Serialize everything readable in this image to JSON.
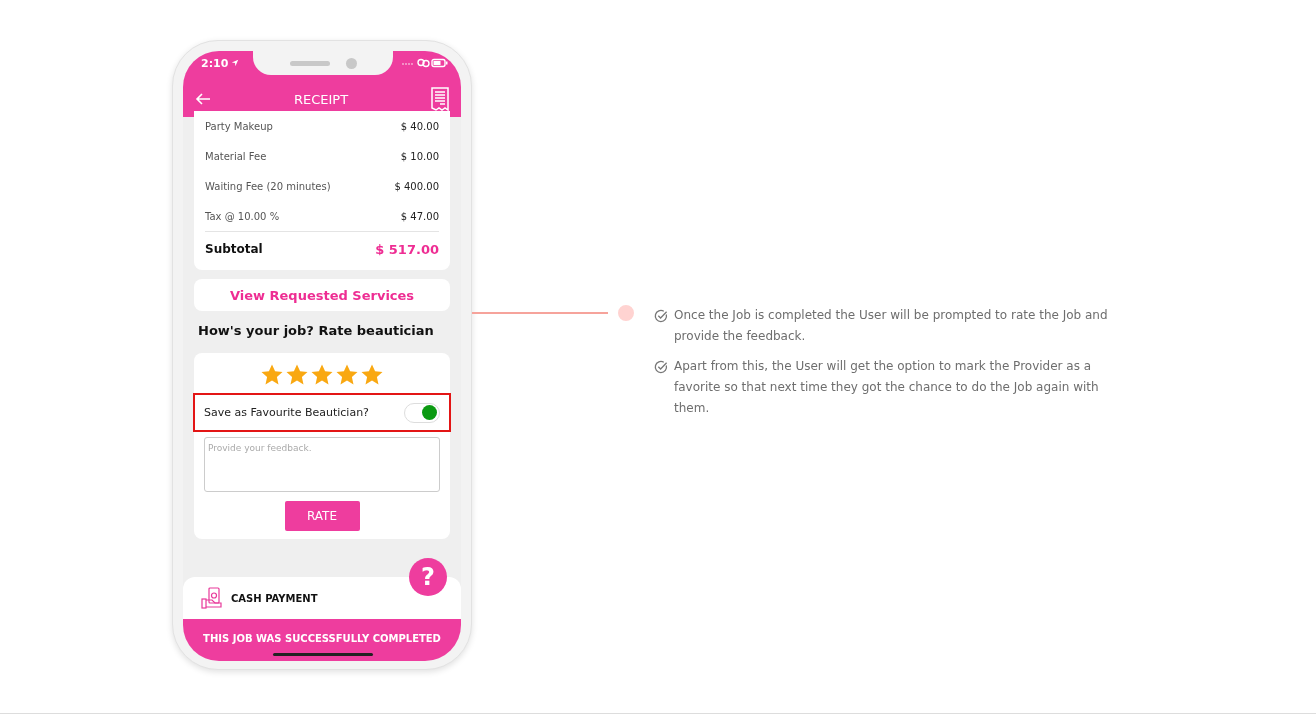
{
  "status_bar": {
    "time": "2:10"
  },
  "header": {
    "title": "RECEIPT"
  },
  "receipt": {
    "lines": [
      {
        "label": "Party Makeup",
        "amount": "$ 40.00"
      },
      {
        "label": "Material Fee",
        "amount": "$ 10.00"
      },
      {
        "label": "Waiting Fee (20 minutes)",
        "amount": "$ 400.00"
      },
      {
        "label": "Tax @ 10.00 %",
        "amount": "$ 47.00"
      }
    ],
    "subtotal_label": "Subtotal",
    "subtotal_amount": "$ 517.00"
  },
  "view_services_button": "View Requested Services",
  "rating": {
    "heading": "How's your job? Rate beautician",
    "stars": 5,
    "favourite_label": "Save as Favourite Beautician?",
    "favourite_on": true,
    "feedback_placeholder": "Provide your feedback.",
    "rate_button": "RATE"
  },
  "help_button": "?",
  "payment": {
    "label": "CASH PAYMENT"
  },
  "completion_banner": "THIS JOB WAS SUCCESSFULLY COMPLETED",
  "notes": [
    {
      "text": "Once the Job is completed the User will be prompted to rate the Job and provide the feedback."
    },
    {
      "text": "Apart from this, the User will get the option to mark the Provider as a favorite so that next time they got the chance to do the Job again with them."
    }
  ]
}
